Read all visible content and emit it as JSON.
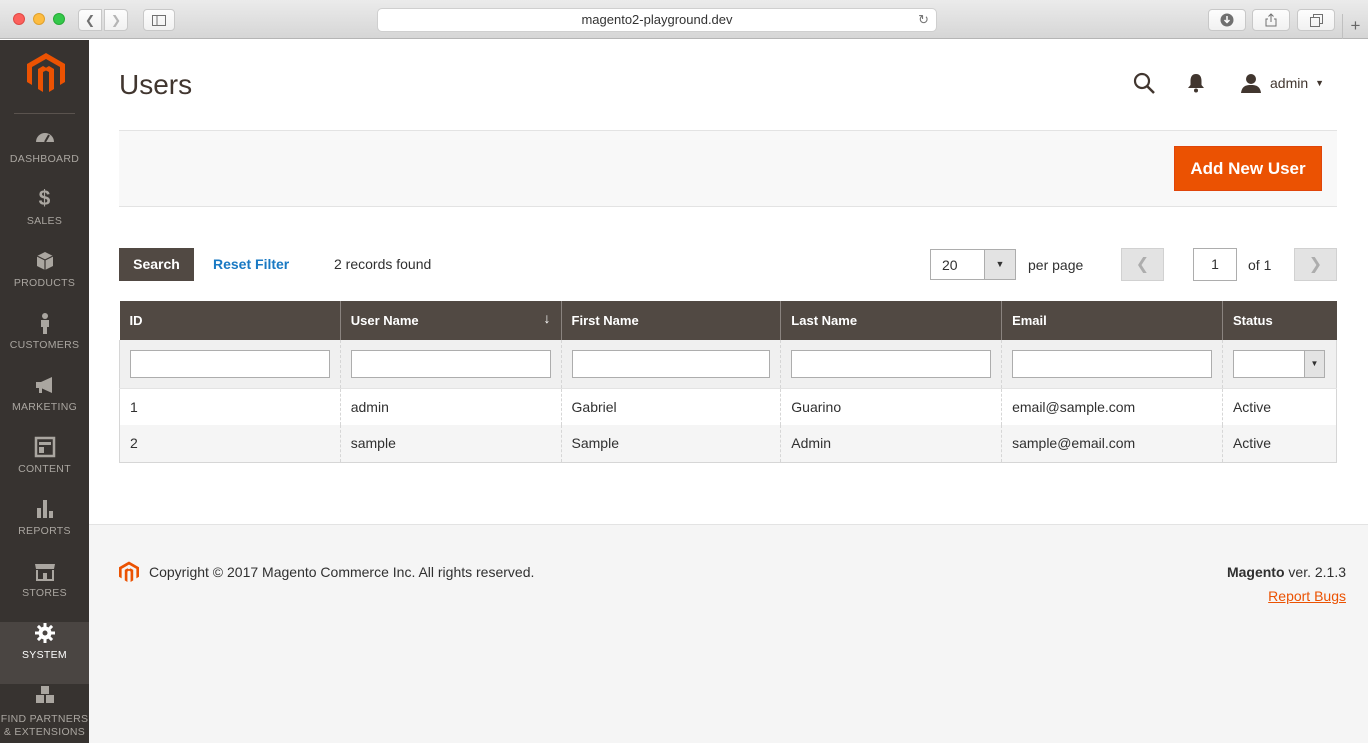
{
  "browser": {
    "url": "magento2-playground.dev"
  },
  "sidebar": {
    "items": [
      {
        "label": "DASHBOARD",
        "icon": "speedometer-icon"
      },
      {
        "label": "SALES",
        "icon": "dollar-icon"
      },
      {
        "label": "PRODUCTS",
        "icon": "cube-icon"
      },
      {
        "label": "CUSTOMERS",
        "icon": "person-icon"
      },
      {
        "label": "MARKETING",
        "icon": "megaphone-icon"
      },
      {
        "label": "CONTENT",
        "icon": "layout-icon"
      },
      {
        "label": "REPORTS",
        "icon": "bar-chart-icon"
      },
      {
        "label": "STORES",
        "icon": "storefront-icon"
      },
      {
        "label": "SYSTEM",
        "icon": "gear-icon"
      },
      {
        "label_line1": "FIND PARTNERS",
        "label_line2": "& EXTENSIONS",
        "icon": "blocks-icon"
      }
    ],
    "active": "SYSTEM"
  },
  "header": {
    "title": "Users",
    "user": "admin"
  },
  "actions": {
    "add_new": "Add New User"
  },
  "toolbar": {
    "search": "Search",
    "reset": "Reset Filter",
    "records": "2 records found",
    "per_page_value": "20",
    "per_page_label": "per page",
    "page": "1",
    "of_pages": "of 1"
  },
  "table": {
    "columns": [
      "ID",
      "User Name",
      "First Name",
      "Last Name",
      "Email",
      "Status"
    ],
    "rows": [
      [
        "1",
        "admin",
        "Gabriel",
        "Guarino",
        "email@sample.com",
        "Active"
      ],
      [
        "2",
        "sample",
        "Sample",
        "Admin",
        "sample@email.com",
        "Active"
      ]
    ]
  },
  "footer": {
    "copyright": "Copyright © 2017 Magento Commerce Inc. All rights reserved.",
    "brand": "Magento",
    "version": " ver. 2.1.3",
    "report_bugs": "Report Bugs"
  },
  "colors": {
    "accent": "#eb5202",
    "sidebar": "#373330",
    "header_bg": "#514943",
    "link": "#1979c3"
  }
}
